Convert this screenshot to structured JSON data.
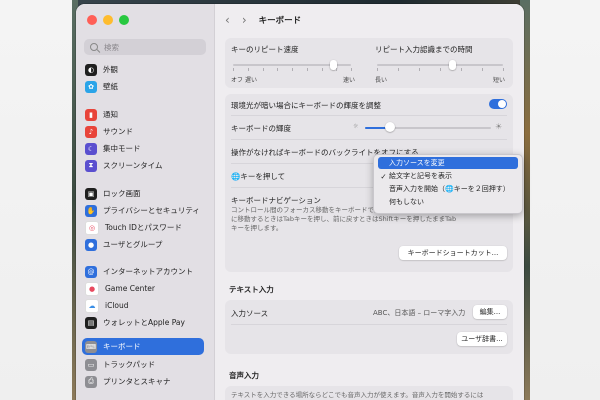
{
  "window": {
    "title": "キーボード"
  },
  "search": {
    "placeholder": "検索"
  },
  "sidebar": {
    "items": [
      {
        "label": "外観",
        "icon": "appearance-icon",
        "color": "#1f1f1f"
      },
      {
        "label": "壁紙",
        "icon": "wallpaper-icon",
        "color": "#2aa4e8"
      },
      {
        "label": "通知",
        "icon": "notifications-icon",
        "color": "#e8443a"
      },
      {
        "label": "サウンド",
        "icon": "sound-icon",
        "color": "#e8443a"
      },
      {
        "label": "集中モード",
        "icon": "focus-icon",
        "color": "#5a4fcf"
      },
      {
        "label": "スクリーンタイム",
        "icon": "screen-time-icon",
        "color": "#5a4fcf"
      },
      {
        "label": "ロック画面",
        "icon": "lock-icon",
        "color": "#1f1f1f"
      },
      {
        "label": "プライバシーとセキュリティ",
        "icon": "privacy-hand-icon",
        "color": "#2f6fdc"
      },
      {
        "label": "Touch IDとパスワード",
        "icon": "fingerprint-icon",
        "color": "#e84a5f"
      },
      {
        "label": "ユーザとグループ",
        "icon": "users-icon",
        "color": "#2f6fdc"
      },
      {
        "label": "インターネットアカウント",
        "icon": "at-icon",
        "color": "#2f6fdc"
      },
      {
        "label": "Game Center",
        "icon": "game-center-icon",
        "color": "#ffffff"
      },
      {
        "label": "iCloud",
        "icon": "cloud-icon",
        "color": "#ffffff"
      },
      {
        "label": "ウォレットとApple Pay",
        "icon": "wallet-icon",
        "color": "#1f1f1f"
      },
      {
        "label": "キーボード",
        "icon": "keyboard-icon",
        "color": "#8e8e93",
        "selected": true
      },
      {
        "label": "トラックパッド",
        "icon": "trackpad-icon",
        "color": "#8e8e93"
      },
      {
        "label": "プリンタとスキャナ",
        "icon": "printer-icon",
        "color": "#8e8e93"
      }
    ]
  },
  "keyboard": {
    "repeat_rate_label": "キーのリピート速度",
    "repeat_rate_min": "オフ",
    "repeat_rate_slow": "遅い",
    "repeat_rate_fast": "速い",
    "repeat_rate_value": 0.85,
    "delay_label": "リピート入力認識までの時間",
    "delay_long": "長い",
    "delay_short": "短い",
    "delay_value": 0.6,
    "ambient_label": "環境光が暗い場合にキーボードの輝度を調整",
    "ambient_on": true,
    "brightness_label": "キーボードの輝度",
    "brightness_value": 0.2,
    "backlight_label": "操作がなければキーボードのバックライトをオフにする",
    "globe_label": "🌐キーを押して",
    "nav_title": "キーボードナビゲーション",
    "nav_desc_1": "コントロール間のフォーカス移動をキーボードで操作できます。",
    "nav_desc_2": "に移動するときはTabキーを押し、前に戻すときはShiftキーを押したままTab",
    "nav_desc_3": "キーを押します。",
    "shortcuts_button": "キーボードショートカット..."
  },
  "text_input": {
    "section_title": "テキスト入力",
    "input_sources_label": "入力ソース",
    "input_sources_value": "ABC、日本語 – ローマ字入力",
    "edit_button": "編集...",
    "user_dictionary_button": "ユーザ辞書..."
  },
  "voice": {
    "section_title": "音声入力",
    "desc": "テキストを入力できる場所ならどこでも音声入力が使えます。音声入力を開始するには"
  },
  "menu": {
    "items": [
      {
        "label": "入力ソースを変更",
        "checked": false,
        "highlighted": true
      },
      {
        "label": "絵文字と記号を表示",
        "checked": true,
        "highlighted": false
      },
      {
        "label": "音声入力を開始（🌐キーを２回押す）",
        "checked": false,
        "highlighted": false
      },
      {
        "label": "何もしない",
        "checked": false,
        "highlighted": false
      }
    ]
  },
  "colors": {
    "accent": "#2f6fdc"
  }
}
